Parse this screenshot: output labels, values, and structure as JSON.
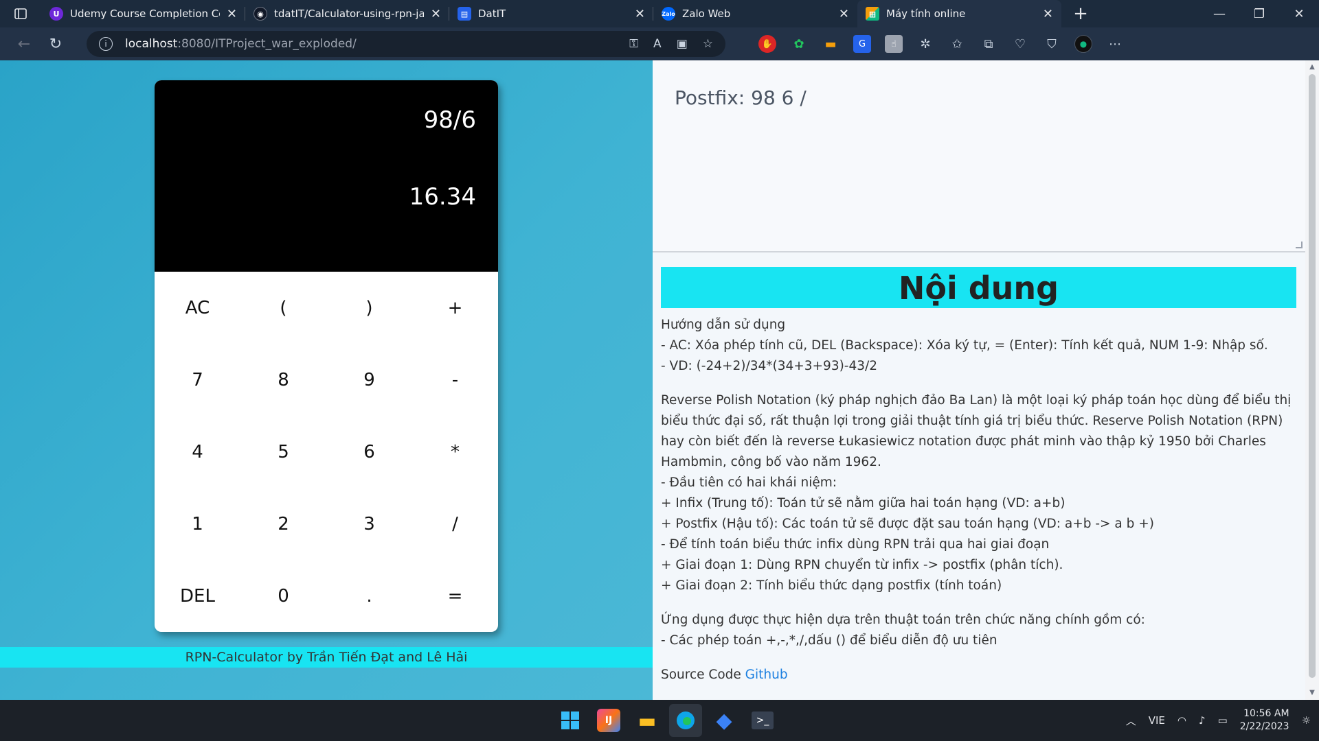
{
  "browser": {
    "tabs": [
      {
        "title": "Udemy Course Completion Certi",
        "favicon": "udemy-icon",
        "color": "#7c3aed"
      },
      {
        "title": "tdatIT/Calculator-using-rpn-java",
        "favicon": "github-icon",
        "color": "#111827"
      },
      {
        "title": "DatIT",
        "favicon": "doc-icon",
        "color": "#2563eb"
      },
      {
        "title": "Zalo Web",
        "favicon": "zalo-icon",
        "color": "#0068ff"
      },
      {
        "title": "Máy tính online",
        "favicon": "calculator-icon",
        "color": "#f59e0b",
        "active": true
      }
    ],
    "address": {
      "host": "localhost",
      "path": ":8080/ITProject_war_exploded/"
    }
  },
  "calculator": {
    "expression": "98/6",
    "result": "16.34",
    "keys": [
      "AC",
      "(",
      ")",
      "+",
      "7",
      "8",
      "9",
      "-",
      "4",
      "5",
      "6",
      "*",
      "1",
      "2",
      "3",
      "/",
      "DEL",
      "0",
      ".",
      "="
    ],
    "footer": "RPN-Calculator by Trần Tiến Đạt and Lê Hải"
  },
  "panel": {
    "postfix": "Postfix: 98 6 /",
    "title": "Nội dung",
    "guide_lines": [
      "Hướng dẫn sử dụng",
      "- AC: Xóa phép tính cũ, DEL (Backspace): Xóa ký tự, = (Enter): Tính kết quả, NUM 1-9: Nhập số.",
      "- VD: (-24+2)/34*(34+3+93)-43/2"
    ],
    "rpn_intro": "Reverse Polish Notation (ký pháp nghịch đảo Ba Lan) là một loại ký pháp toán học dùng để biểu thị biểu thức đại số, rất thuận lợi trong giải thuật tính giá trị biểu thức. Reserve Polish Notation (RPN) hay còn biết đến là reverse Łukasiewicz notation được phát minh vào thập kỷ 1950 bởi Charles Hambmin, công bố vào năm 1962.",
    "rpn_lines": [
      "- Đầu tiên có hai khái niệm:",
      "+ Infix (Trung tố): Toán tử sẽ nằm giữa hai toán hạng (VD: a+b)",
      "+ Postfix (Hậu tố): Các toán tử sẽ được đặt sau toán hạng (VD: a+b -> a b +)",
      "- Để tính toán biểu thức infix dùng RPN trải qua hai giai đoạn",
      "+ Giai đoạn 1: Dùng RPN chuyển từ infix -> postfix (phân tích).",
      "+ Giai đoạn 2: Tính biểu thức dạng postfix (tính toán)"
    ],
    "app_lines": [
      "Ứng dụng được thực hiện dựa trên thuật toán trên chức năng chính gồm có:",
      "- Các phép toán +,-,*,/,dấu () để biểu diễn độ ưu tiên"
    ],
    "source_label": "Source Code",
    "source_link": "Github"
  },
  "taskbar": {
    "language": "VIE",
    "time": "10:56 AM",
    "date": "2/22/2023"
  }
}
